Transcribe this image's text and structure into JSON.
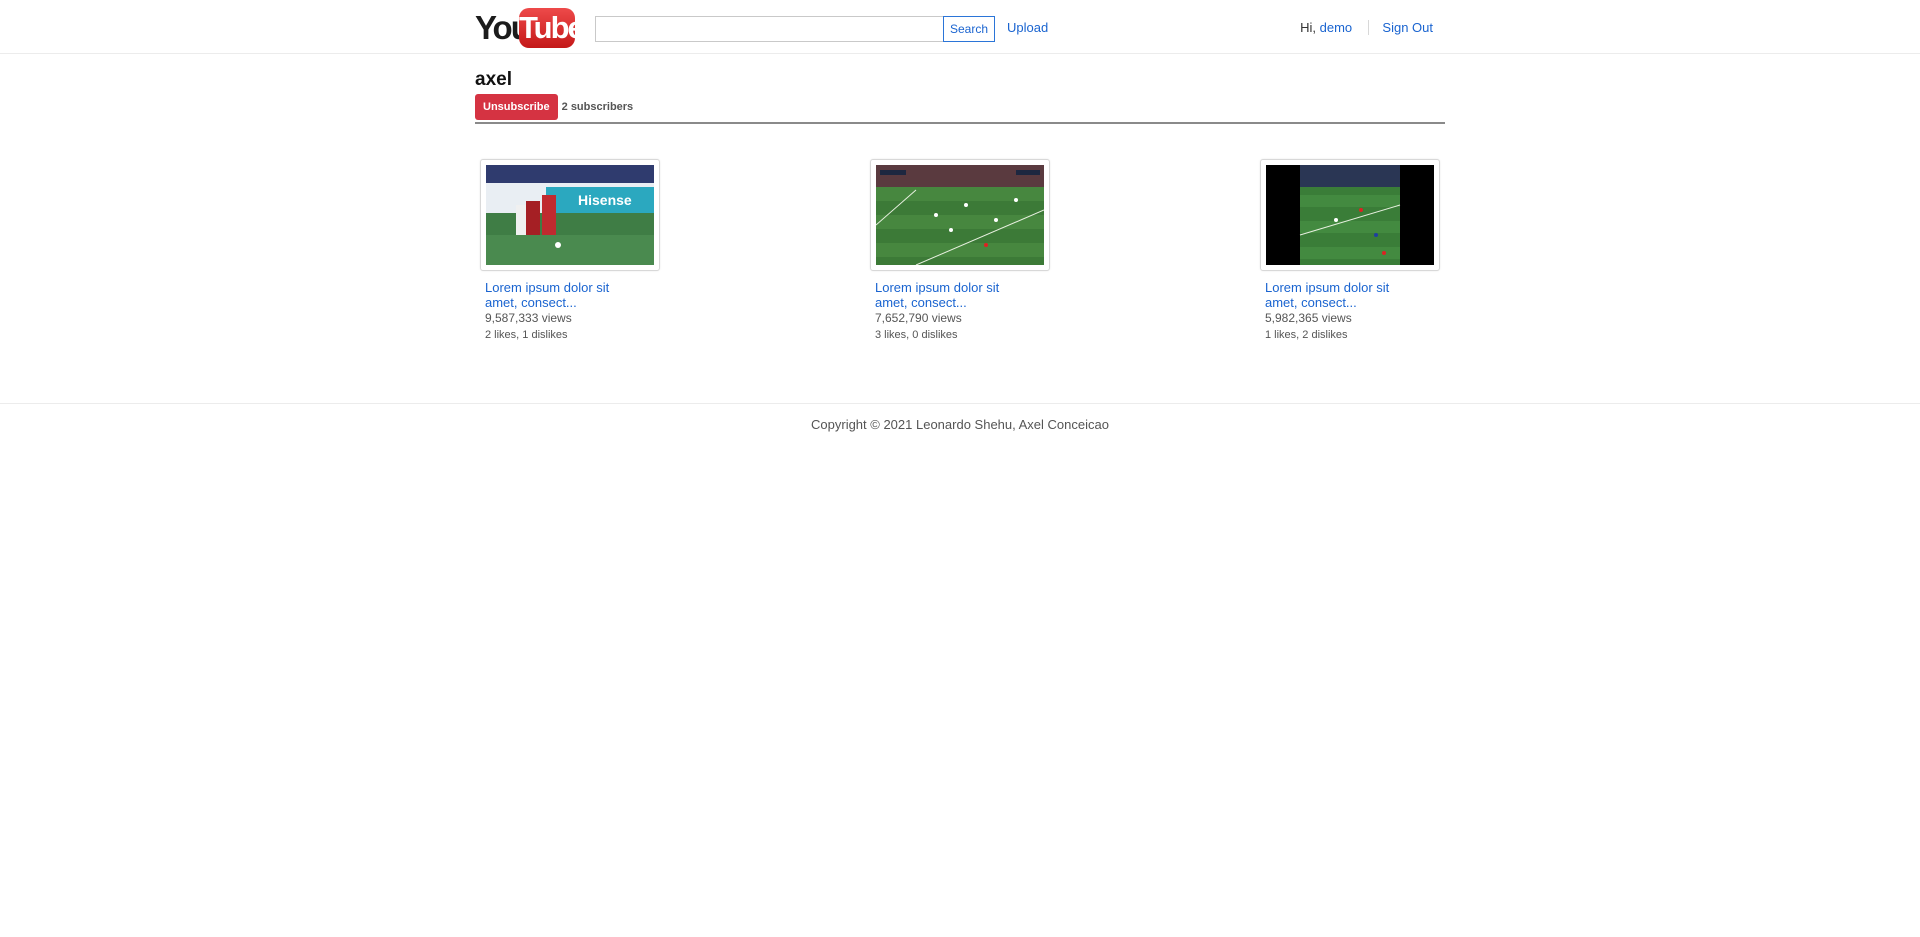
{
  "header": {
    "logo": {
      "text_you": "You",
      "text_tube": "Tube"
    },
    "search": {
      "value": "",
      "placeholder": "",
      "button_label": "Search"
    },
    "upload_label": "Upload",
    "greeting": "Hi,",
    "username": "demo",
    "signout_label": "Sign Out"
  },
  "channel": {
    "name": "axel",
    "unsubscribe_label": "Unsubscribe",
    "subscribers": "2 subscribers"
  },
  "videos": [
    {
      "title": "Lorem ipsum dolor sit amet, consect...",
      "views": "9,587,333 views",
      "likes": "2 likes, 1 dislikes",
      "thumbnail": "soccer-players-closeup"
    },
    {
      "title": "Lorem ipsum dolor sit amet, consect...",
      "views": "7,652,790 views",
      "likes": "3 likes, 0 dislikes",
      "thumbnail": "soccer-pitch-wide"
    },
    {
      "title": "Lorem ipsum dolor sit amet, consect...",
      "views": "5,982,365 views",
      "likes": "1 likes, 2 dislikes",
      "thumbnail": "soccer-pitch-letterboxed"
    }
  ],
  "footer": {
    "copyright": "Copyright © 2021 Leonardo Shehu, Axel Conceicao"
  },
  "colors": {
    "link": "#1a64d0",
    "unsubscribe": "#d53342",
    "logo_red": "#d42020"
  }
}
